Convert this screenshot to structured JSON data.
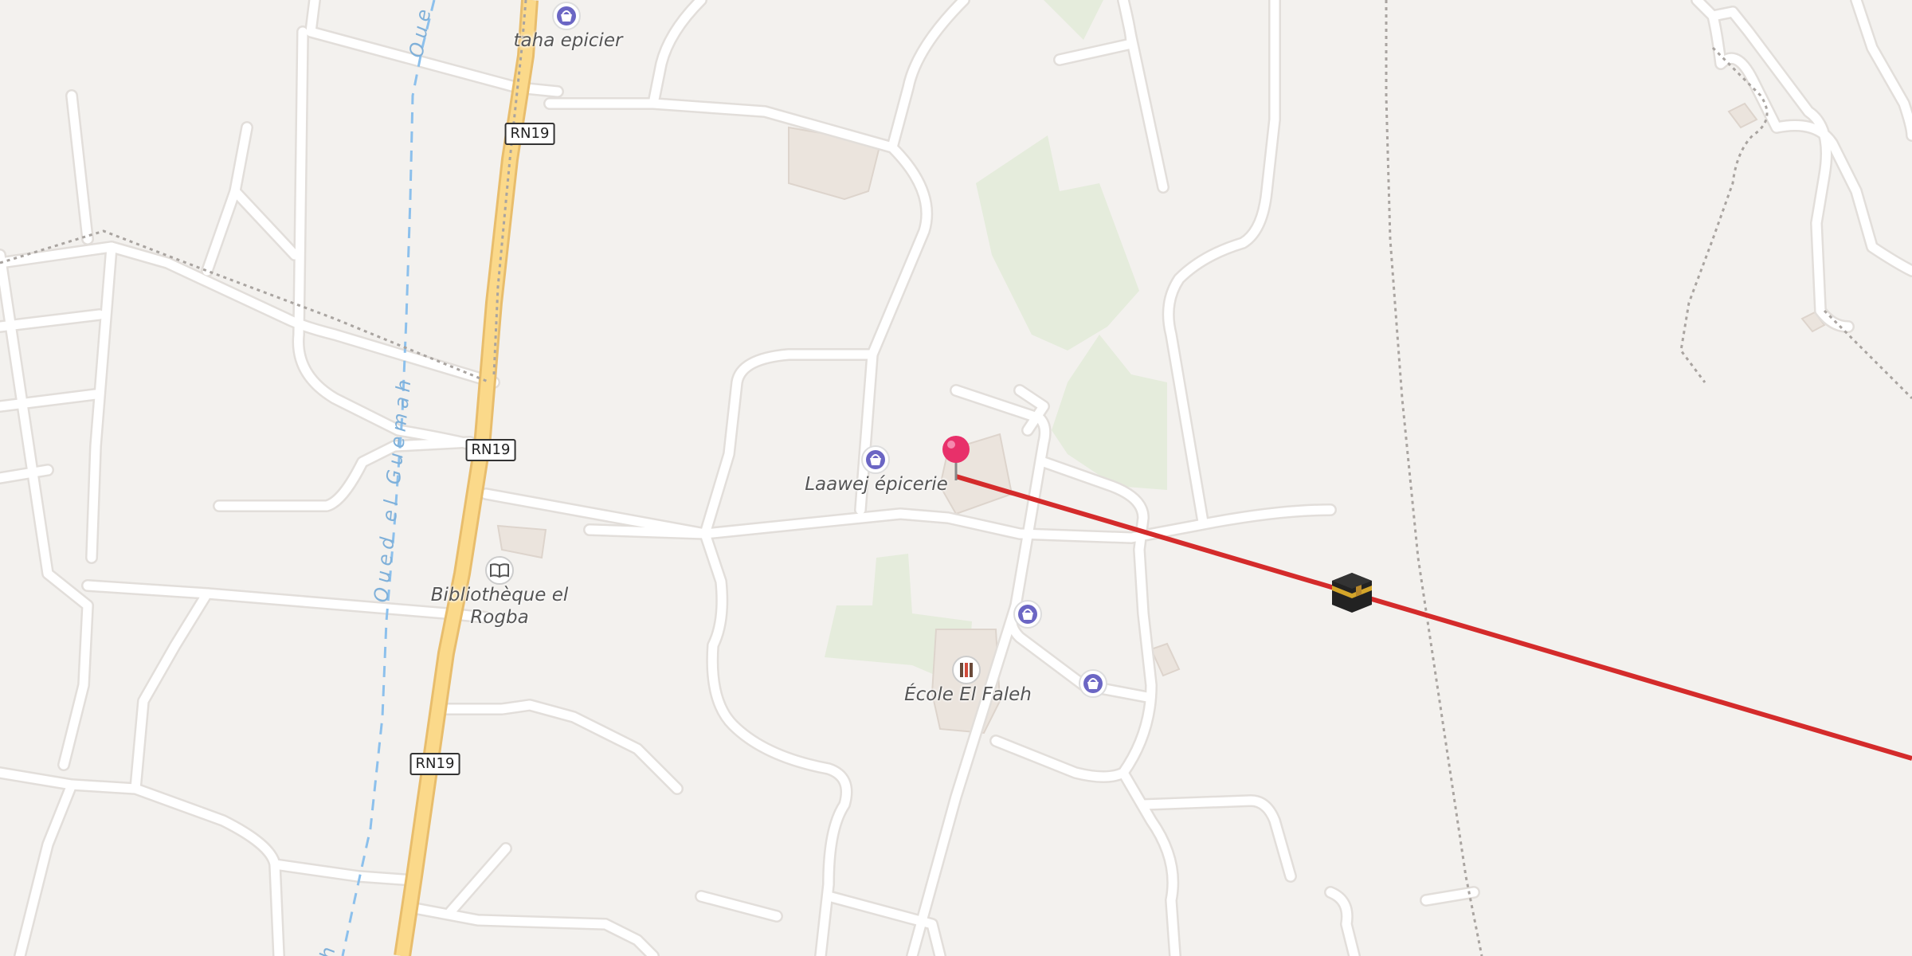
{
  "map": {
    "colors": {
      "background": "#f3f1ee",
      "road": "#ffffff",
      "road_casing": "#e2deda",
      "primary_road": "#fbd98a",
      "primary_casing": "#e8bd6c",
      "vegetation": "#e5ecdc",
      "building": "#ece6e0",
      "waterway": "#8cc0ec",
      "path": "#a9a4a0",
      "direction_line": "#d42b2b",
      "pin": "#e8306a",
      "poi_icon": "#6b66c4"
    },
    "road_shields": [
      {
        "label": "RN19"
      },
      {
        "label": "RN19"
      },
      {
        "label": "RN19"
      }
    ],
    "water_labels": [
      {
        "label": "Oued el Guemah"
      },
      {
        "label": "Oue"
      },
      {
        "label": "h"
      }
    ],
    "pois": [
      {
        "label": "taha epicier",
        "icon": "basket-icon"
      },
      {
        "label": "Laawej épicerie",
        "icon": "basket-icon"
      },
      {
        "label": "Bibliothèque el Rogba",
        "icon": "book-icon"
      },
      {
        "label": "École El Faleh",
        "icon": "school-icon"
      },
      {
        "label": "",
        "icon": "basket-icon"
      },
      {
        "label": "",
        "icon": "basket-icon"
      }
    ],
    "markers": {
      "location_pin": "map-pin-icon",
      "qibla_target": "kaaba-icon"
    }
  }
}
